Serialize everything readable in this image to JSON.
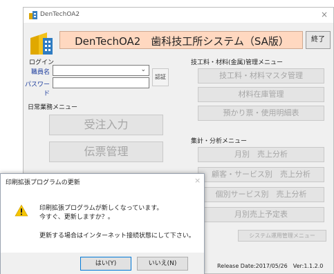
{
  "window": {
    "title": "DenTechOA2",
    "close": "×"
  },
  "header": {
    "title": "DenTechOA2　歯科技工所システム（SA版）",
    "exit_label": "終了"
  },
  "login": {
    "group_label": "ログイン",
    "staff_label": "職員名",
    "password_label": "パスワード",
    "auth_label": "認証"
  },
  "daily": {
    "group_label": "日常業務メニュー",
    "buttons": [
      "受注入力",
      "伝票管理"
    ]
  },
  "material": {
    "group_label": "技工料・材料(金属)管理メニュー",
    "buttons": [
      "技工料・材料マスタ管理",
      "材料在庫管理",
      "預かり票・使用明細表"
    ]
  },
  "analysis": {
    "group_label": "集計・分析メニュー",
    "buttons": [
      "月別　売上分析",
      "顧客・サービス別　売上分析",
      "個別サービス別　売上分析",
      "月別売上予定表"
    ]
  },
  "system": {
    "button": "システム運用管理メニュー"
  },
  "footer": {
    "release": "Release Date:2017/05/26　Ver:1.1.2.0"
  },
  "dialog": {
    "title": "印刷拡張プログラムの更新",
    "close": "×",
    "message_line1": "印刷拡張プログラムが新しくなっています。",
    "message_line2": "今すぐ、更新しますか？。",
    "message_line3": "更新する場合はインターネット接続状態にして下さい。",
    "yes_label": "はい(Y)",
    "no_label": "いいえ(N)"
  },
  "colors": {
    "banner": "#ffd8c0",
    "warning": "#f5c400",
    "accent": "#0078d7"
  }
}
